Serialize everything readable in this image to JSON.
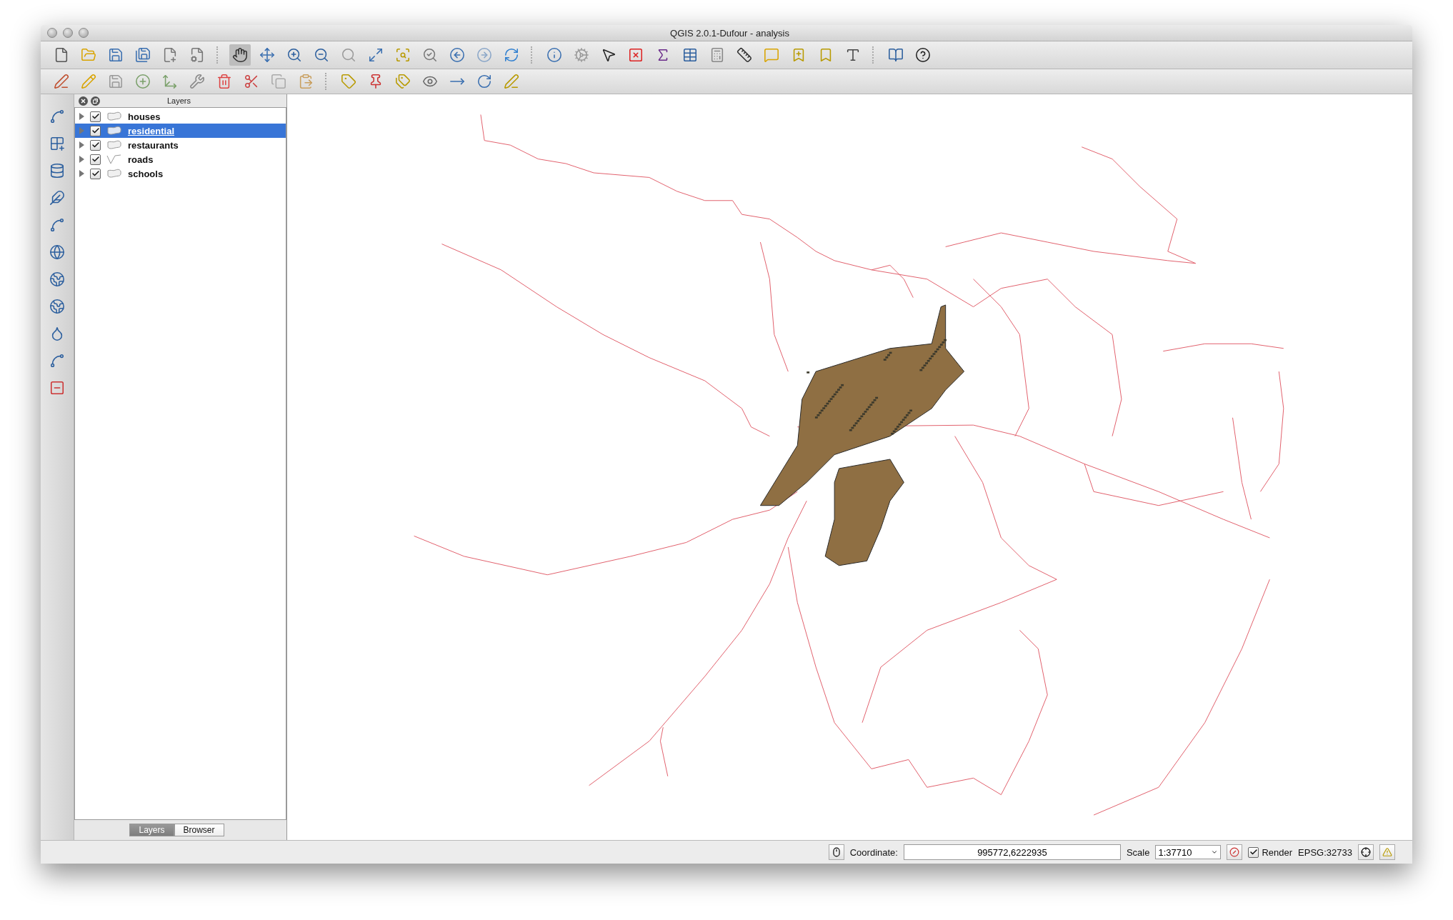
{
  "window": {
    "title": "QGIS 2.0.1-Dufour - analysis"
  },
  "layers_panel": {
    "title": "Layers",
    "layers": [
      {
        "name": "houses",
        "kind": "polygon",
        "checked": true,
        "selected": false
      },
      {
        "name": "residential",
        "kind": "polygon",
        "checked": true,
        "selected": true
      },
      {
        "name": "restaurants",
        "kind": "polygon",
        "checked": true,
        "selected": false
      },
      {
        "name": "roads",
        "kind": "line",
        "checked": true,
        "selected": false
      },
      {
        "name": "schools",
        "kind": "polygon",
        "checked": true,
        "selected": false
      }
    ],
    "tabs": [
      {
        "label": "Layers",
        "selected": true
      },
      {
        "label": "Browser",
        "selected": false
      }
    ]
  },
  "status_bar": {
    "coordinate_label": "Coordinate:",
    "coordinate": "995772,6222935",
    "scale_label": "Scale",
    "scale": "1:37710",
    "render": {
      "label": "Render",
      "checked": true
    },
    "crs": "EPSG:32733"
  }
}
